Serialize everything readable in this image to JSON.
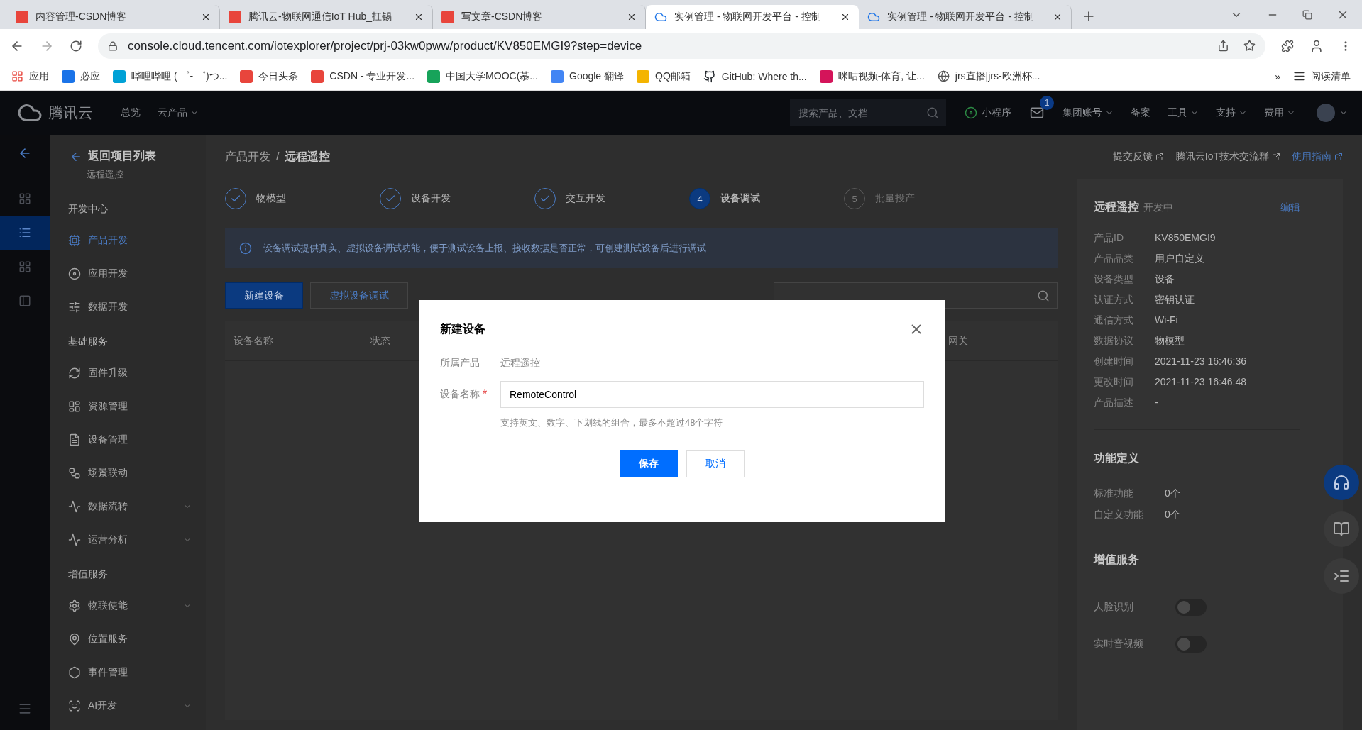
{
  "browser": {
    "tabs": [
      {
        "title": "内容管理-CSDN博客",
        "selected": false
      },
      {
        "title": "腾讯云-物联网通信IoT Hub_扛锡",
        "selected": false
      },
      {
        "title": "写文章-CSDN博客",
        "selected": false
      },
      {
        "title": "实例管理 - 物联网开发平台 - 控制",
        "selected": true
      },
      {
        "title": "实例管理 - 物联网开发平台 - 控制",
        "selected": false
      }
    ],
    "url": "console.cloud.tencent.com/iotexplorer/project/prj-03kw0pww/product/KV850EMGI9?step=device",
    "bookmarks": [
      "应用",
      "必应",
      "哔哩哔哩 ( ゜- ゜)つ...",
      "今日头条",
      "CSDN - 专业开发...",
      "中国大学MOOC(慕...",
      "Google 翻译",
      "QQ邮箱",
      "GitHub: Where th...",
      "咪咕视频-体育, 让...",
      "jrs直播|jrs-欧洲杯..."
    ],
    "overflow": "»",
    "reading_list": "阅读清单"
  },
  "header": {
    "brand": "腾讯云",
    "nav": [
      {
        "label": "总览",
        "dropdown": false
      },
      {
        "label": "云产品",
        "dropdown": true
      }
    ],
    "search_placeholder": "搜索产品、文档",
    "mini_program": "小程序",
    "mail_badge": "1",
    "menu": [
      {
        "label": "集团账号",
        "dropdown": true
      },
      {
        "label": "备案",
        "dropdown": false
      },
      {
        "label": "工具",
        "dropdown": true
      },
      {
        "label": "支持",
        "dropdown": true
      },
      {
        "label": "费用",
        "dropdown": true
      }
    ]
  },
  "rail": [
    {
      "selected": false
    },
    {
      "selected": true
    },
    {
      "selected": false
    },
    {
      "selected": false
    }
  ],
  "sidebar": {
    "back": "返回项目列表",
    "project": "远程遥控",
    "sections": [
      {
        "title": "开发中心",
        "items": [
          {
            "label": "产品开发",
            "selected": true,
            "submenu": false
          },
          {
            "label": "应用开发",
            "selected": false,
            "submenu": false
          },
          {
            "label": "数据开发",
            "selected": false,
            "submenu": false
          }
        ]
      },
      {
        "title": "基础服务",
        "items": [
          {
            "label": "固件升级",
            "selected": false,
            "submenu": false
          },
          {
            "label": "资源管理",
            "selected": false,
            "submenu": false
          },
          {
            "label": "设备管理",
            "selected": false,
            "submenu": false
          },
          {
            "label": "场景联动",
            "selected": false,
            "submenu": false
          },
          {
            "label": "数据流转",
            "selected": false,
            "submenu": true
          },
          {
            "label": "运营分析",
            "selected": false,
            "submenu": true
          }
        ]
      },
      {
        "title": "增值服务",
        "items": [
          {
            "label": "物联使能",
            "selected": false,
            "submenu": true
          },
          {
            "label": "位置服务",
            "selected": false,
            "submenu": false
          },
          {
            "label": "事件管理",
            "selected": false,
            "submenu": false
          },
          {
            "label": "AI开发",
            "selected": false,
            "submenu": true
          }
        ]
      }
    ]
  },
  "breadcrumb": [
    "产品开发",
    "/",
    "远程遥控"
  ],
  "help_links": [
    {
      "label": "提交反馈",
      "primary": false
    },
    {
      "label": "腾讯云IoT技术交流群",
      "primary": false
    },
    {
      "label": "使用指南",
      "primary": true
    }
  ],
  "steps": [
    {
      "label": "物模型",
      "kind": "done"
    },
    {
      "label": "设备开发",
      "kind": "done"
    },
    {
      "label": "交互开发",
      "kind": "done"
    },
    {
      "number": "4",
      "label": "设备调试",
      "kind": "current"
    },
    {
      "number": "5",
      "label": "批量投产",
      "kind": "pending"
    }
  ],
  "notice": "设备调试提供真实、虚拟设备调试功能，便于测试设备上报、接收数据是否正常，可创建测试设备后进行调试",
  "toolbar": [
    {
      "label": "新建设备",
      "primary": true
    },
    {
      "label": "虚拟设备调试",
      "primary": false
    }
  ],
  "table": {
    "columns": [
      "设备名称",
      "状态",
      "网关"
    ]
  },
  "product": {
    "name": "远程遥控",
    "status": "开发中",
    "edit": "编辑",
    "props": [
      {
        "label": "产品ID",
        "value": "KV850EMGI9"
      },
      {
        "label": "产品品类",
        "value": "用户自定义"
      },
      {
        "label": "设备类型",
        "value": "设备"
      },
      {
        "label": "认证方式",
        "value": "密钥认证"
      },
      {
        "label": "通信方式",
        "value": "Wi-Fi"
      },
      {
        "label": "数据协议",
        "value": "物模型"
      },
      {
        "label": "创建时间",
        "value": "2021-11-23 16:46:36"
      },
      {
        "label": "更改时间",
        "value": "2021-11-23 16:46:48"
      },
      {
        "label": "产品描述",
        "value": "-"
      }
    ],
    "functions_title": "功能定义",
    "functions": [
      {
        "label": "标准功能",
        "value": "0个"
      },
      {
        "label": "自定义功能",
        "value": "0个"
      }
    ],
    "services_title": "增值服务",
    "services": [
      {
        "label": "人脸识别",
        "on": false
      },
      {
        "label": "实时音视频",
        "on": false
      }
    ]
  },
  "dialog": {
    "title": "新建设备",
    "product_label": "所属产品",
    "product_value": "远程遥控",
    "name_label": "设备名称",
    "required_mark": "*",
    "name_value": "RemoteControl",
    "hint": "支持英文、数字、下划线的组合，最多不超过48个字符",
    "buttons": [
      {
        "label": "保存",
        "primary": true
      },
      {
        "label": "取消",
        "primary": false
      }
    ]
  }
}
